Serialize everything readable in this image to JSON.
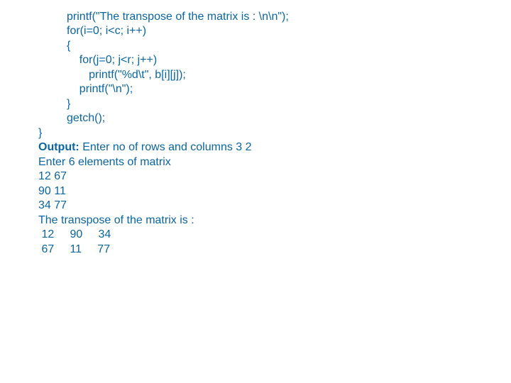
{
  "code": {
    "l1": "         printf(\"The transpose of the matrix is : \\n\\n\");",
    "l2": "         for(i=0; i<c; i++)",
    "l3": "         {",
    "l4": "             for(j=0; j<r; j++)",
    "l5": "                printf(\"%d\\t\", b[i][j]);",
    "l6": "             printf(\"\\n\");",
    "l7": "         }",
    "l8": "         getch();",
    "l9": "}"
  },
  "output_label": "Output:",
  "output": {
    "l1": " Enter no of rows and columns 3 2",
    "l2": "Enter 6 elements of matrix",
    "l3": "12 67",
    "l4": "90 11",
    "l5": "34 77",
    "l6": "The transpose of the matrix is :",
    "l7": " 12     90     34",
    "l8": " 67     11     77"
  }
}
